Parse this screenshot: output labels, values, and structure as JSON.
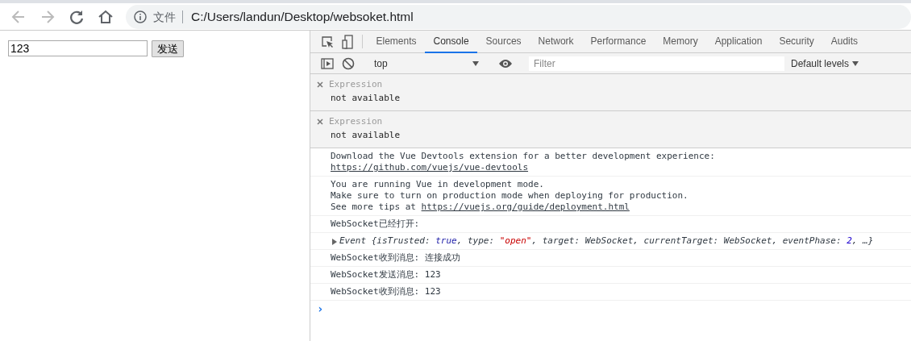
{
  "browser": {
    "address_scheme": "文件",
    "address": "C:/Users/landun/Desktop/websoket.html"
  },
  "page": {
    "input_value": "123",
    "send_button": "发送"
  },
  "devtools": {
    "tabs": [
      {
        "label": "Elements",
        "selected": false
      },
      {
        "label": "Console",
        "selected": true
      },
      {
        "label": "Sources",
        "selected": false
      },
      {
        "label": "Network",
        "selected": false
      },
      {
        "label": "Performance",
        "selected": false
      },
      {
        "label": "Memory",
        "selected": false
      },
      {
        "label": "Application",
        "selected": false
      },
      {
        "label": "Security",
        "selected": false
      },
      {
        "label": "Audits",
        "selected": false
      }
    ],
    "context": "top",
    "filter_placeholder": "Filter",
    "levels": "Default levels",
    "expressions": [
      {
        "label": "Expression",
        "value": "not available"
      },
      {
        "label": "Expression",
        "value": "not available"
      }
    ],
    "messages": [
      {
        "kind": "log",
        "lines": [
          {
            "text": "Download the Vue Devtools extension for a better development experience:"
          },
          {
            "link": "https://github.com/vuejs/vue-devtools"
          }
        ]
      },
      {
        "kind": "log",
        "lines": [
          {
            "text": "You are running Vue in development mode."
          },
          {
            "text": "Make sure to turn on production mode when deploying for production."
          },
          {
            "text": "See more tips at ",
            "link": "https://vuejs.org/guide/deployment.html"
          }
        ]
      },
      {
        "kind": "log",
        "lines": [
          {
            "text": "WebSocket已经打开:"
          }
        ]
      },
      {
        "kind": "object",
        "tokens": [
          {
            "kind": "plain",
            "text": "Event {isTrusted: "
          },
          {
            "kind": "keyword",
            "text": "true"
          },
          {
            "kind": "plain",
            "text": ", type: "
          },
          {
            "kind": "string",
            "text": "\"open\""
          },
          {
            "kind": "plain",
            "text": ", target: WebSocket, currentTarget: WebSocket, eventPhase: "
          },
          {
            "kind": "number",
            "text": "2"
          },
          {
            "kind": "plain",
            "text": ", …}"
          }
        ]
      },
      {
        "kind": "log",
        "lines": [
          {
            "text": "WebSocket收到消息: 连接成功"
          }
        ]
      },
      {
        "kind": "log",
        "lines": [
          {
            "text": "WebSocket发送消息: 123"
          }
        ]
      },
      {
        "kind": "log",
        "lines": [
          {
            "text": "WebSocket收到消息: 123"
          }
        ]
      }
    ],
    "prompt": "›"
  }
}
